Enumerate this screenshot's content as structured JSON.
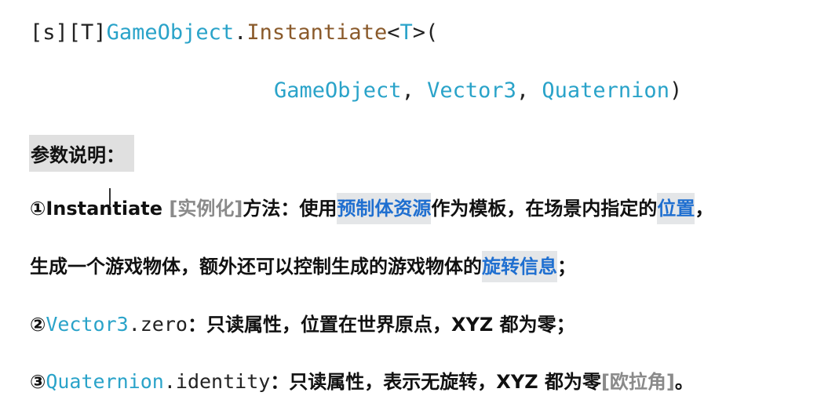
{
  "signature": {
    "s_tag": "[s]",
    "t_tag": "[T]",
    "class": "GameObject",
    "dot": ".",
    "method": "Instantiate",
    "lt": "<",
    "generic": "T",
    "gt": ">(",
    "param1": "GameObject",
    "comma1": ", ",
    "param2": "Vector3",
    "comma2": ", ",
    "param3": "Quaternion",
    "close": ")"
  },
  "heading": "参数说明：",
  "item1": {
    "num": "①",
    "name": "Instantiate",
    "note": "[实例化]",
    "text_a": "方法：使用",
    "hl1": "预制体资源",
    "text_b": "作为模板，在场景内指定的",
    "hl2": "位置",
    "text_c": "，",
    "line2_a": "生成一个游戏物体，额外还可以控制生成的游戏物体的",
    "hl3": "旋转信息",
    "line2_b": "；"
  },
  "item2": {
    "num": "②",
    "type": "Vector3",
    "member": ".zero",
    "text": "：只读属性，位置在世界原点，XYZ 都为零；"
  },
  "item3": {
    "num": "③",
    "type": "Quaternion",
    "member": ".identity",
    "text": "：只读属性，表示无旋转，XYZ 都为零",
    "note": "[欧拉角]",
    "end": "。"
  }
}
